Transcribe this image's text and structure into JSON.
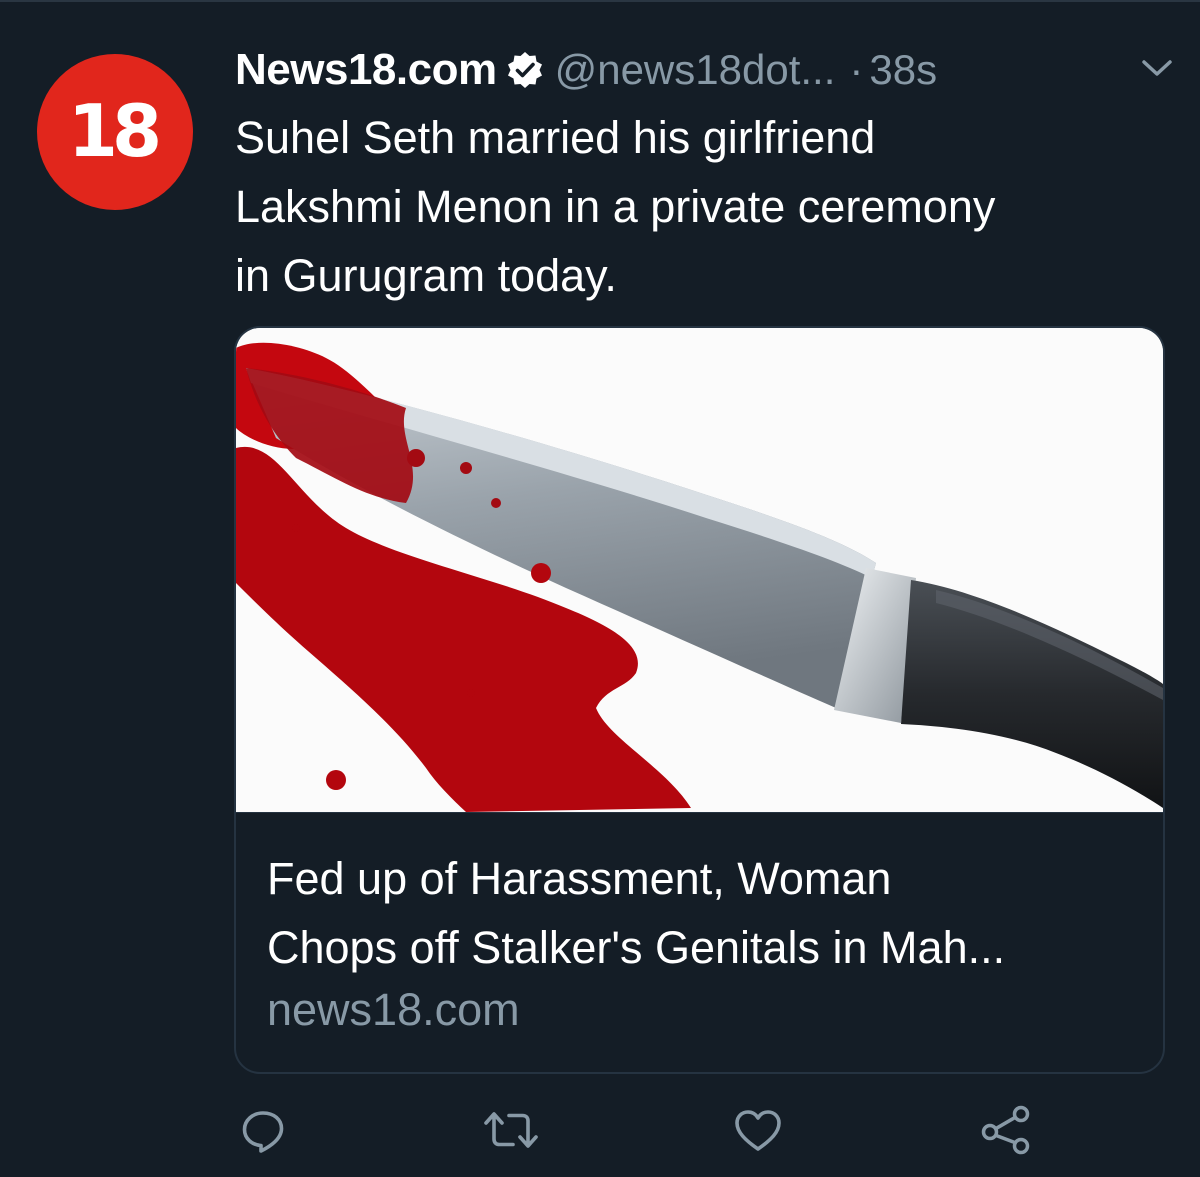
{
  "tweet": {
    "avatar_text": "18",
    "author_name": "News18.com",
    "handle": "@news18dot...",
    "separator": "·",
    "time": "38s",
    "text_lines": [
      "Suhel Seth married his girlfriend",
      "Lakshmi Menon in a private ceremony",
      "in Gurugram today."
    ]
  },
  "card": {
    "title_lines": [
      "Fed up of Harassment, Woman",
      "Chops off Stalker's Genitals in Mah..."
    ],
    "domain": "news18.com",
    "image_subject": "bloody-knife-image"
  },
  "actions": [
    {
      "icon": "reply-icon"
    },
    {
      "icon": "retweet-icon"
    },
    {
      "icon": "like-icon"
    },
    {
      "icon": "share-icon"
    }
  ],
  "colors": {
    "background": "#141d26",
    "secondary_text": "#8899a6",
    "avatar": "#e1261c",
    "card_border": "#253341"
  }
}
